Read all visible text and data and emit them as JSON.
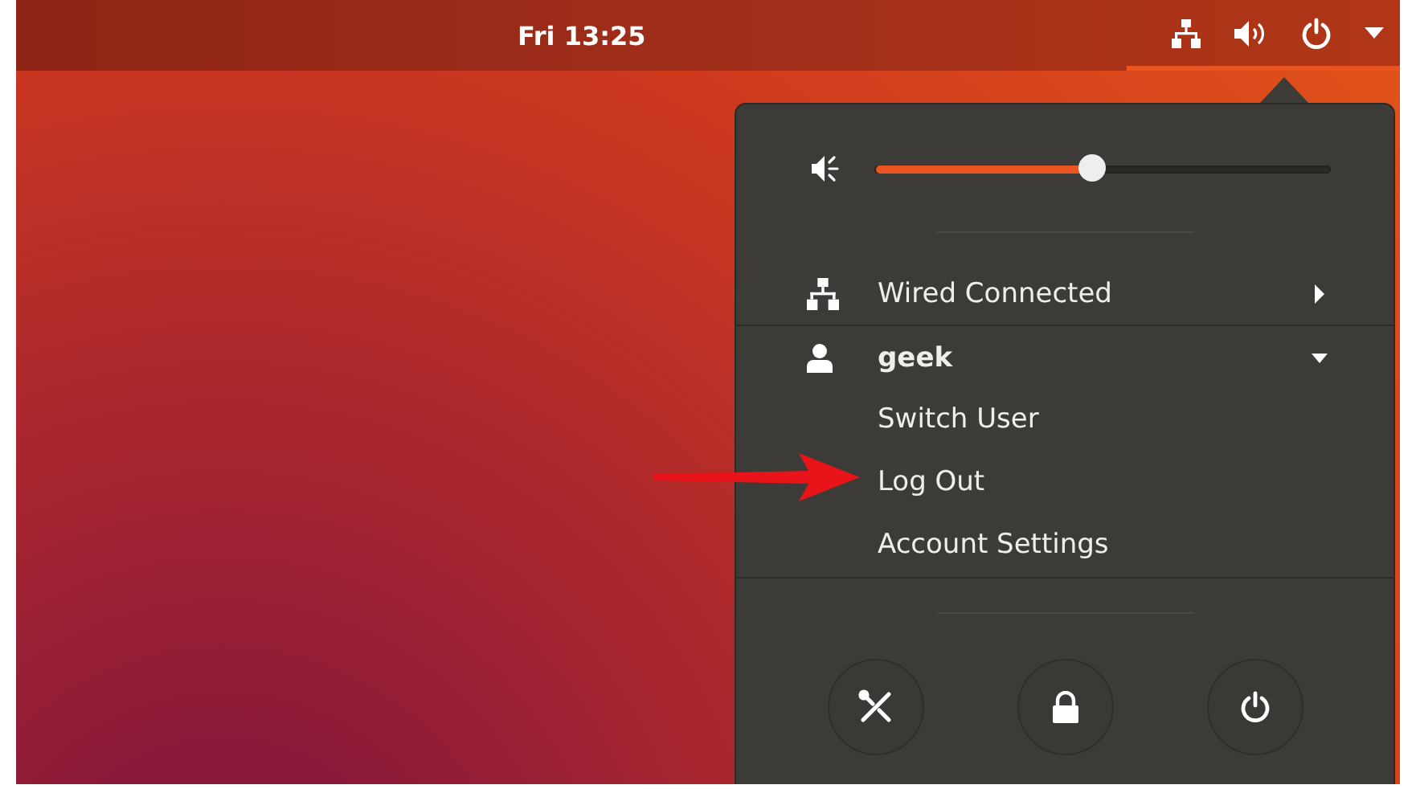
{
  "top_bar": {
    "clock": "Fri 13:25"
  },
  "menu": {
    "volume": {
      "level": 0.475
    },
    "items": [
      {
        "kind": "network",
        "label": "Wired Connected",
        "expanded": false
      },
      {
        "kind": "user",
        "label": "geek",
        "expanded": true,
        "children": [
          {
            "label": "Switch User"
          },
          {
            "label": "Log Out"
          },
          {
            "label": "Account Settings"
          }
        ]
      }
    ],
    "buttons": [
      {
        "kind": "settings"
      },
      {
        "kind": "lock"
      },
      {
        "kind": "power"
      }
    ]
  }
}
